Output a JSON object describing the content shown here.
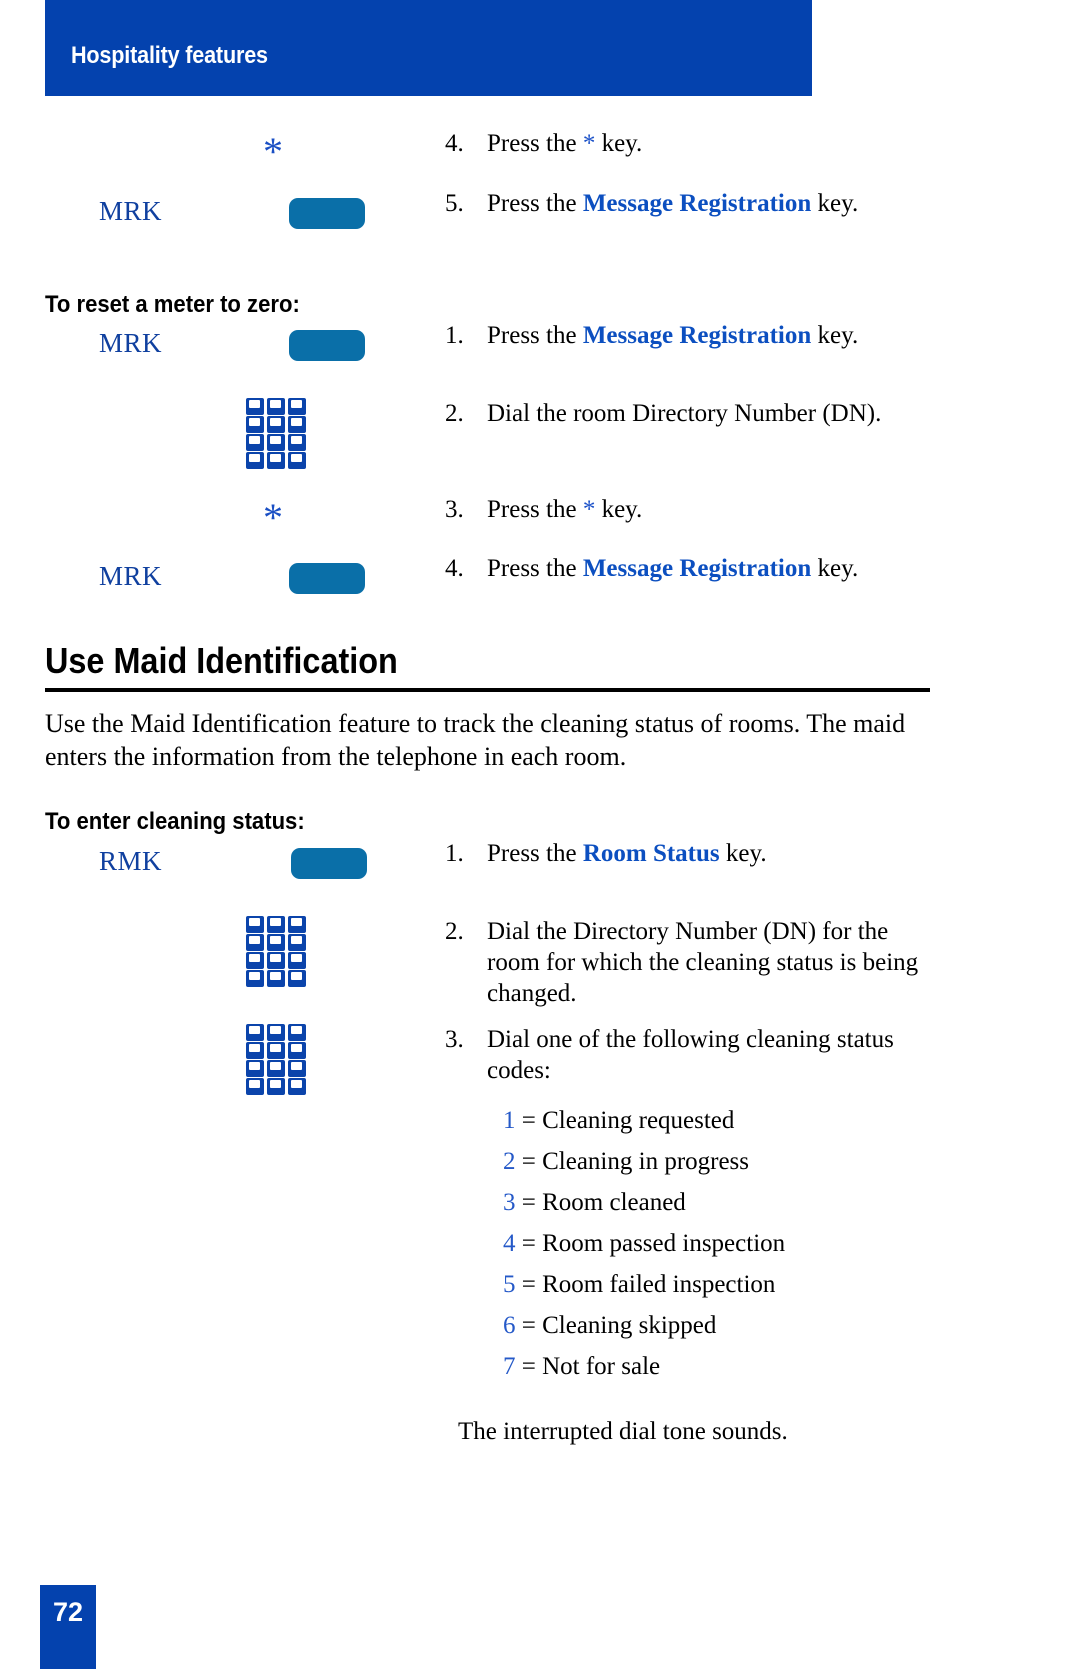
{
  "header": {
    "title": "Hospitality features"
  },
  "colors": {
    "header_blue": "#0442AE",
    "soft_key_blue": "#0A6FA8",
    "keypad_blue": "#0B44AB",
    "keyword_blue": "#0C4FC0",
    "label_blue": "#10409F",
    "code_num_blue": "#2559C8"
  },
  "continued_steps": [
    {
      "num": "4.",
      "pre": "Press the ",
      "star": "*",
      "post": " key.",
      "icon": "star",
      "icon_label": ""
    },
    {
      "num": "5.",
      "pre": "Press the ",
      "keyword": "Message Registration",
      "post": " key.",
      "icon": "softkey",
      "icon_label": "MRK"
    }
  ],
  "reset_meter": {
    "heading": "To reset a meter to zero:",
    "steps": [
      {
        "num": "1.",
        "pre": "Press the ",
        "keyword": "Message Registration",
        "post": " key.",
        "icon": "softkey",
        "icon_label": "MRK"
      },
      {
        "num": "2.",
        "pre": "Dial the room Directory Number (DN).",
        "post": "",
        "icon": "keypad",
        "icon_label": ""
      },
      {
        "num": "3.",
        "pre": "Press the ",
        "star": "*",
        "post": " key.",
        "icon": "star",
        "icon_label": ""
      },
      {
        "num": "4.",
        "pre": "Press the ",
        "keyword": "Message Registration",
        "post": " key.",
        "icon": "softkey",
        "icon_label": "MRK"
      }
    ]
  },
  "maid_section": {
    "title": "Use Maid Identification",
    "intro": "Use the Maid Identification feature to track the cleaning status of rooms. The maid enters the information from the telephone in each room.",
    "heading": "To enter cleaning status:",
    "steps": [
      {
        "num": "1.",
        "pre": "Press the ",
        "keyword": "Room Status",
        "post": " key.",
        "icon": "softkey",
        "icon_label": "RMK"
      },
      {
        "num": "2.",
        "pre": "Dial the Directory Number (DN) for the room for which the cleaning status is being changed.",
        "post": "",
        "icon": "keypad",
        "icon_label": ""
      },
      {
        "num": "3.",
        "pre": "Dial one of the following cleaning status codes:",
        "post": "",
        "icon": "keypad",
        "icon_label": ""
      }
    ],
    "status_codes": [
      {
        "num": "1",
        "sep": " = ",
        "label": "Cleaning requested"
      },
      {
        "num": "2",
        "sep": " = ",
        "label": "Cleaning in progress"
      },
      {
        "num": "3",
        "sep": " = ",
        "label": "Room cleaned"
      },
      {
        "num": "4",
        "sep": " = ",
        "label": "Room passed inspection"
      },
      {
        "num": "5",
        "sep": " = ",
        "label": "Room failed inspection"
      },
      {
        "num": "6",
        "sep": " = ",
        "label": "Cleaning skipped"
      },
      {
        "num": "7",
        "sep": " = ",
        "label": "Not for sale"
      }
    ],
    "closing_note": "The interrupted dial tone sounds."
  },
  "footer": {
    "page_number": "72"
  }
}
